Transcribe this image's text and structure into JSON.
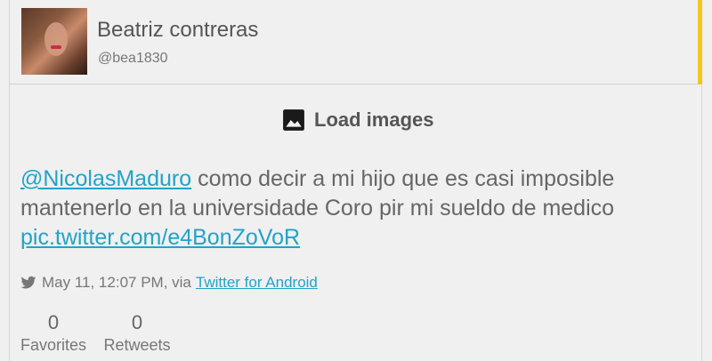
{
  "user": {
    "name": "Beatriz contreras",
    "handle": "@bea1830"
  },
  "load_images": {
    "label": "Load images",
    "icon": "image-icon"
  },
  "tweet": {
    "mention": "@NicolasMaduro",
    "text": " como decir a mi hijo que es casi imposible mantenerlo en la universidade Coro pir mi sueldo de medico ",
    "link": "pic.twitter.com/e4BonZoVoR"
  },
  "meta": {
    "icon": "twitter-bird-icon",
    "timestamp": "May 11, 12:07 PM, via",
    "source": "Twitter for Android"
  },
  "stats": {
    "favorites": {
      "count": "0",
      "label": "Favorites"
    },
    "retweets": {
      "count": "0",
      "label": "Retweets"
    }
  },
  "colors": {
    "accent": "#f5c51e",
    "link": "#22a3c8",
    "background": "#f0f0f0"
  }
}
